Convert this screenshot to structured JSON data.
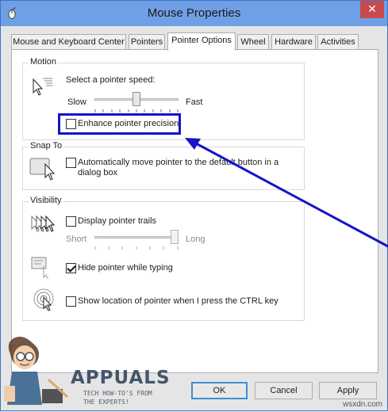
{
  "window": {
    "title": "Mouse Properties",
    "close_glyph": "✕"
  },
  "tabs": [
    {
      "label": "Mouse and Keyboard Center",
      "active": false
    },
    {
      "label": "Pointers",
      "active": false
    },
    {
      "label": "Pointer Options",
      "active": true
    },
    {
      "label": "Wheel",
      "active": false
    },
    {
      "label": "Hardware",
      "active": false
    },
    {
      "label": "Activities",
      "active": false
    }
  ],
  "motion": {
    "title": "Motion",
    "speed_label": "Select a pointer speed:",
    "slow_label": "Slow",
    "fast_label": "Fast",
    "speed_level": 0.5,
    "enhance_label": "Enhance pointer precision",
    "enhance_checked": false
  },
  "snap_to": {
    "title": "Snap To",
    "label": "Automatically move pointer to the default button in a dialog box",
    "checked": false
  },
  "visibility": {
    "title": "Visibility",
    "trails_label": "Display pointer trails",
    "trails_checked": false,
    "short_label": "Short",
    "long_label": "Long",
    "trail_level": 1.0,
    "hide_label": "Hide pointer while typing",
    "hide_checked": true,
    "ctrl_label": "Show location of pointer when I press the CTRL key",
    "ctrl_checked": false
  },
  "buttons": {
    "ok": "OK",
    "cancel": "Cancel",
    "apply": "Apply"
  },
  "annotation_color": "#1414c8",
  "watermark": {
    "logo_text": "APPUALS",
    "tagline_line1": "TECH HOW-TO'S FROM",
    "tagline_line2": "THE EXPERTS!",
    "site": "wsxdn.com"
  }
}
